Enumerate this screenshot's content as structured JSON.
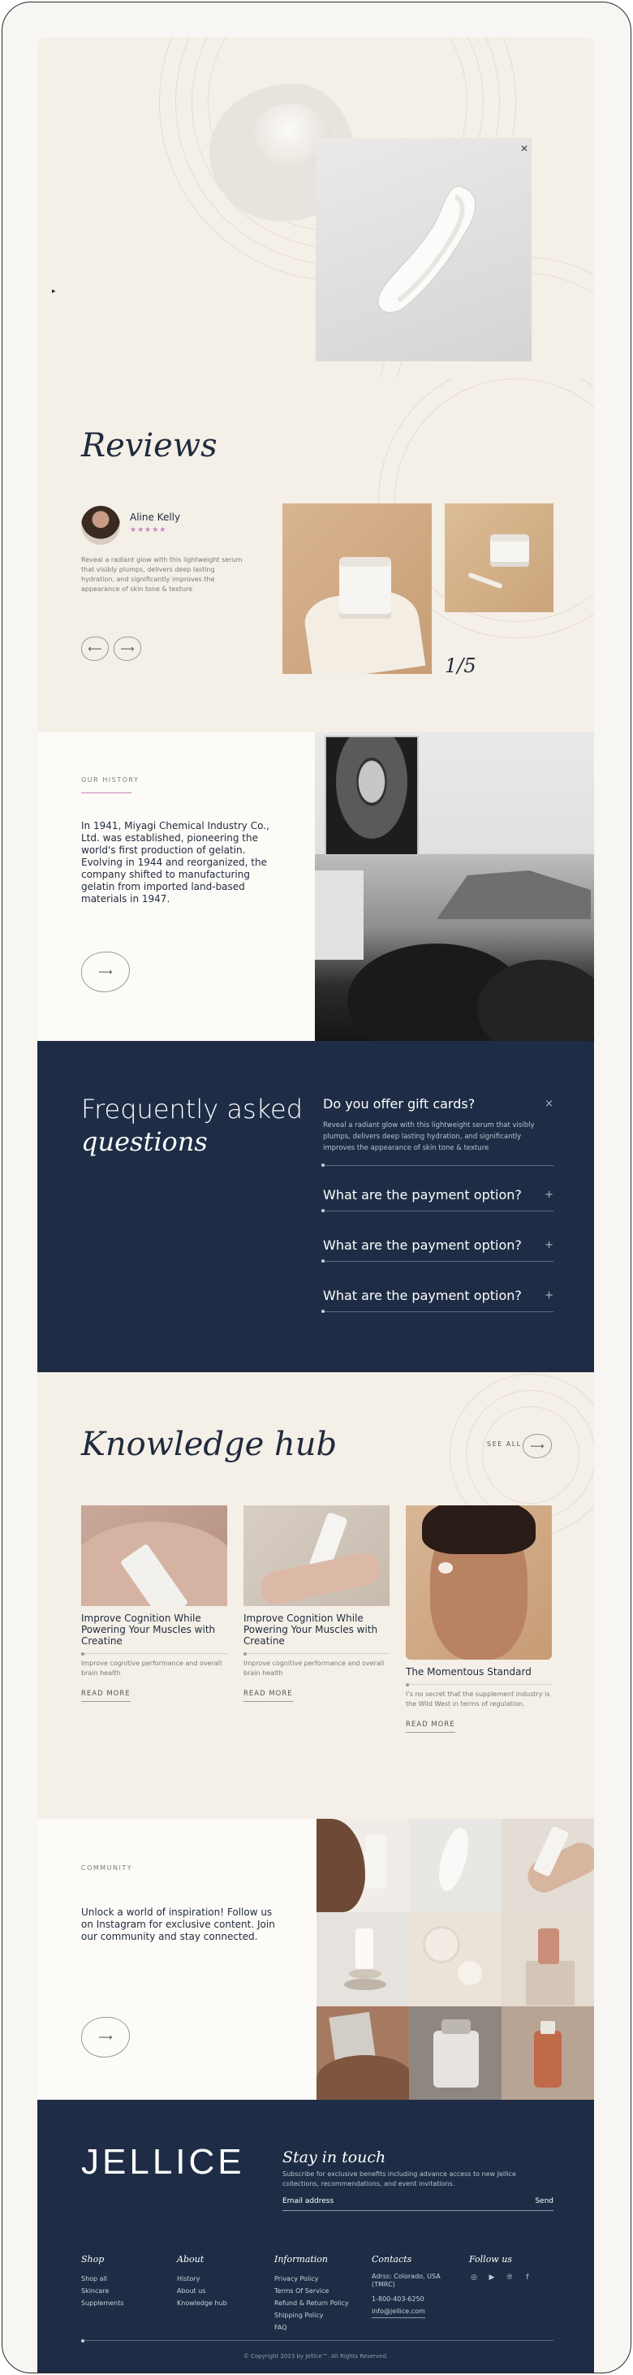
{
  "reviews": {
    "title": "Reviews",
    "reviewer_name": "Aline Kelly",
    "stars": "★★★★★",
    "text": "Reveal a radiant glow with this lightweight serum that visibly plumps, delivers deep lasting hydration, and significantly improves the appearance of skin tone & texture",
    "counter": "1/5"
  },
  "history": {
    "kicker": "OUR HISTORY",
    "text": "In 1941, Miyagi Chemical Industry Co., Ltd. was established, pioneering the world's first production of gelatin. Evolving in 1944 and reorganized, the company shifted to manufacturing gelatin from imported land-based materials in 1947."
  },
  "faq": {
    "heading_line1": "Frequently asked",
    "heading_line2": "questions",
    "items": [
      {
        "question": "Do you offer gift cards?",
        "answer": "Reveal a radiant glow with this lightweight serum that visibly plumps, delivers deep lasting hydration, and significantly improves the appearance of skin tone & texture",
        "icon": "×"
      },
      {
        "question": "What are the payment option?",
        "icon": "+"
      },
      {
        "question": "What are the payment option?",
        "icon": "+"
      },
      {
        "question": "What are the payment option?",
        "icon": "+"
      }
    ]
  },
  "knowledge": {
    "title": "Knowledge hub",
    "see_all": "SEE ALL",
    "cards": [
      {
        "title": "Improve Cognition While Powering Your Muscles with Creatine",
        "desc": "Improve cognitive performance and overall brain health",
        "read_more": "READ MORE"
      },
      {
        "title": "Improve Cognition While Powering Your Muscles with Creatine",
        "desc": "Improve cognitive performance and overall brain health",
        "read_more": "READ MORE"
      },
      {
        "title": "The Momentous Standard",
        "desc": "I’s no secret that the supplement industry is the Wild West in terms of regulation.",
        "read_more": "READ MORE"
      }
    ]
  },
  "community": {
    "kicker": "COMMUNITY",
    "text": "Unlock a world of inspiration! Follow us on Instagram for exclusive content. Join our community and stay connected."
  },
  "footer": {
    "brand": "JELLICE",
    "stay_title": "Stay in touch",
    "stay_sub": "Subscribe for exclusive benefits including advance access to new Jellice collections, recommendations, and event invitations.",
    "email_placeholder": "Email address",
    "send": "Send",
    "shop": {
      "heading": "Shop",
      "links": [
        "Shop all",
        "Skincare",
        "Supplements"
      ]
    },
    "about": {
      "heading": "About",
      "links": [
        "History",
        "About us",
        "Knowledge hub"
      ]
    },
    "information": {
      "heading": "Information",
      "links": [
        "Privacy Policy",
        "Terms Of Service",
        "Refund & Return Policy",
        "Shipping Policy",
        "FAQ"
      ]
    },
    "contacts": {
      "heading": "Contacts",
      "address": "Adrss: Colorado, USA (TMRC)",
      "phone": "1-800-403-6250",
      "email": "info@jellice.com"
    },
    "follow": {
      "heading": "Follow us",
      "icons": [
        "instagram-icon",
        "youtube-icon",
        "pinterest-icon",
        "facebook-icon"
      ]
    },
    "copyright": "© Copyright 2023 by Jellice™. All Rights Reserved."
  }
}
